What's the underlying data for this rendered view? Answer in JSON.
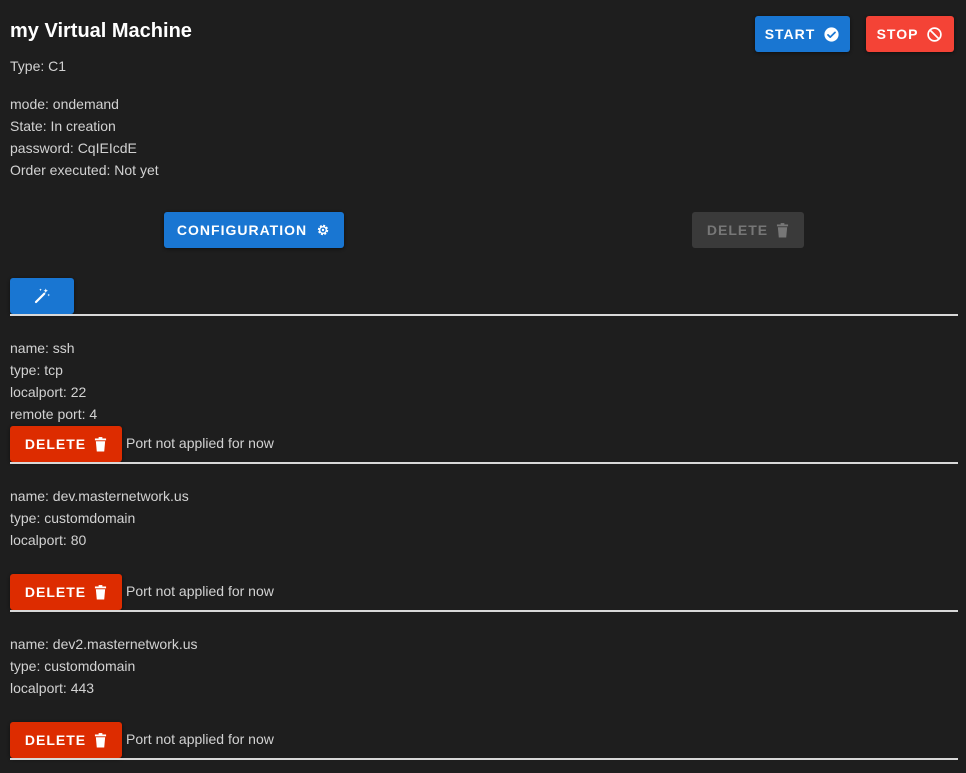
{
  "vm": {
    "title": "my Virtual Machine",
    "type": "Type: C1",
    "mode": "mode: ondemand",
    "state": "State: In creation",
    "password": "password: CqIEIcdE",
    "order": "Order executed: Not yet"
  },
  "header_actions": {
    "start_label": "START",
    "start_icon": "check-circle-icon",
    "stop_label": "STOP",
    "stop_icon": "block-icon"
  },
  "actions": {
    "configuration_label": "CONFIGURATION",
    "configuration_icon": "gear-icon",
    "delete_label": "DELETE",
    "delete_icon": "trash-icon",
    "magic_icon": "magic-wand-icon"
  },
  "ports": [
    {
      "name": "name: ssh",
      "type": "type: tcp",
      "localport": "localport: 22",
      "remoteport": "remote port: 4",
      "delete_label": "DELETE",
      "status": "Port not applied for now"
    },
    {
      "name": "name: dev.masternetwork.us",
      "type": "type: customdomain",
      "localport": "localport: 80",
      "delete_label": "DELETE",
      "status": "Port not applied for now"
    },
    {
      "name": "name: dev2.masternetwork.us",
      "type": "type: customdomain",
      "localport": "localport: 443",
      "delete_label": "DELETE",
      "status": "Port not applied for now"
    }
  ],
  "colors": {
    "background": "#1e1e1e",
    "primary": "#1976d2",
    "stop": "#f44336",
    "delete": "#dd2c00",
    "disabled": "#3a3a3a"
  }
}
